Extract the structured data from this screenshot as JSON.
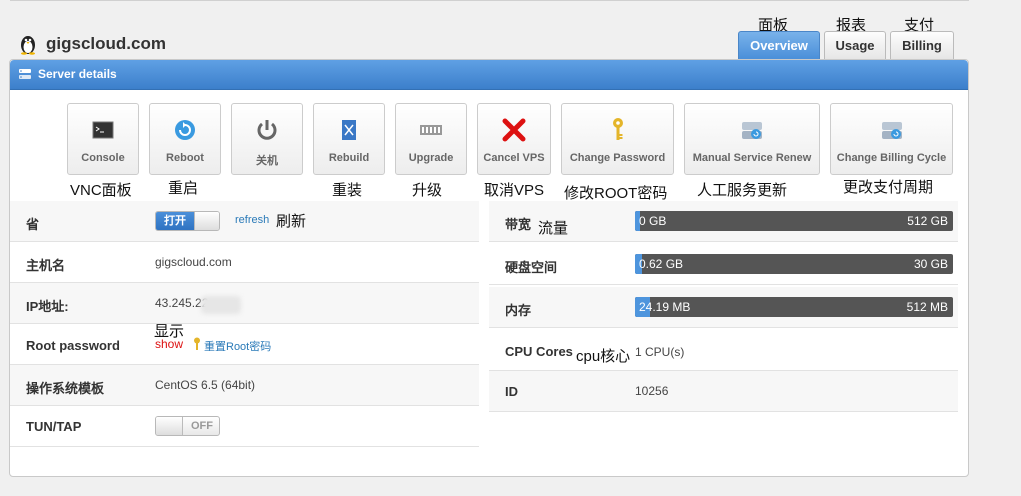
{
  "site": {
    "title": "gigscloud.com"
  },
  "tabs": [
    {
      "label": "Overview",
      "annotation": "面板"
    },
    {
      "label": "Usage",
      "annotation": "报表"
    },
    {
      "label": "Billing",
      "annotation": "支付"
    }
  ],
  "panel": {
    "title": "Server details"
  },
  "actions": [
    {
      "label": "Console",
      "annotation": "VNC面板",
      "icon": "console-icon"
    },
    {
      "label": "Reboot",
      "annotation": "重启",
      "icon": "reboot-icon"
    },
    {
      "label": "关机",
      "annotation": "",
      "icon": "power-icon"
    },
    {
      "label": "Rebuild",
      "annotation": "重装",
      "icon": "rebuild-icon"
    },
    {
      "label": "Upgrade",
      "annotation": "升级",
      "icon": "upgrade-icon"
    },
    {
      "label": "Cancel VPS",
      "annotation": "取消VPS",
      "icon": "cancel-icon"
    },
    {
      "label": "Change Password",
      "annotation": "修改ROOT密码",
      "icon": "key-icon"
    },
    {
      "label": "Manual Service Renew",
      "annotation": "人工服务更新",
      "icon": "renew-icon"
    },
    {
      "label": "Change Billing Cycle",
      "annotation": "更改支付周期",
      "icon": "billing-cycle-icon"
    }
  ],
  "left": {
    "power": {
      "label": "省",
      "toggle_on": "打开",
      "refresh": "refresh",
      "refresh_annotation": "刷新"
    },
    "hostname": {
      "label": "主机名",
      "value": "gigscloud.com"
    },
    "ip": {
      "label": "IP地址:",
      "value": "43.245.22"
    },
    "root_password": {
      "label": "Root password",
      "show": "show",
      "show_annotation": "显示",
      "reset": "重置Root密码"
    },
    "os": {
      "label": "操作系统模板",
      "value": "CentOS 6.5 (64bit)"
    },
    "tuntap": {
      "label": "TUN/TAP",
      "toggle_off": "OFF"
    }
  },
  "right": {
    "bandwidth": {
      "label": "带宽",
      "annotation": "流量",
      "used": "0 GB",
      "total": "512 GB",
      "fraction": 0.0
    },
    "disk": {
      "label": "硬盘空间",
      "used": "0.62 GB",
      "total": "30 GB",
      "fraction": 0.021
    },
    "memory": {
      "label": "内存",
      "used": "24.19 MB",
      "total": "512 MB",
      "fraction": 0.047
    },
    "cpu": {
      "label": "CPU Cores",
      "annotation": "cpu核心",
      "value": "1 CPU(s)"
    },
    "id": {
      "label": "ID",
      "value": "10256"
    }
  }
}
